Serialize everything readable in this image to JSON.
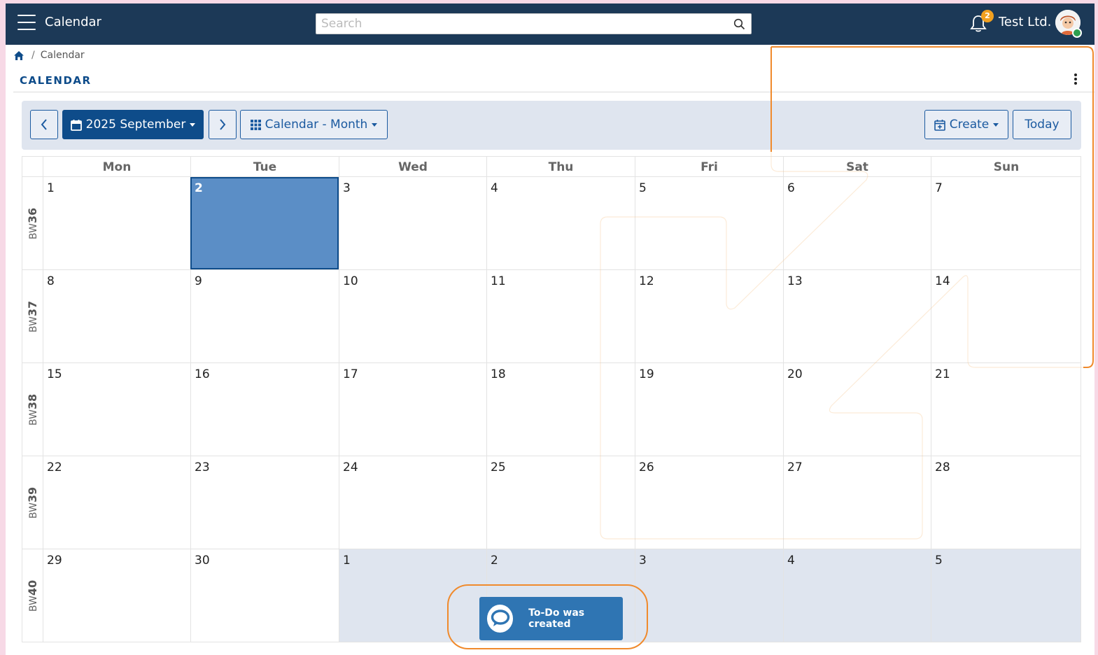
{
  "header": {
    "app_title": "Calendar",
    "search_placeholder": "Search",
    "notification_count": "2",
    "company": "Test Ltd."
  },
  "breadcrumb": {
    "current": "Calendar"
  },
  "page": {
    "heading": "CALENDAR"
  },
  "toolbar": {
    "month_label": "2025 September",
    "view_label": "Calendar - Month",
    "create_label": "Create",
    "today_label": "Today"
  },
  "calendar": {
    "days_of_week": [
      "Mon",
      "Tue",
      "Wed",
      "Thu",
      "Fri",
      "Sat",
      "Sun"
    ],
    "weeks": [
      {
        "prefix": "BW",
        "number": "36",
        "days": [
          "1",
          "2",
          "3",
          "4",
          "5",
          "6",
          "7"
        ]
      },
      {
        "prefix": "BW",
        "number": "37",
        "days": [
          "8",
          "9",
          "10",
          "11",
          "12",
          "13",
          "14"
        ]
      },
      {
        "prefix": "BW",
        "number": "38",
        "days": [
          "15",
          "16",
          "17",
          "18",
          "19",
          "20",
          "21"
        ]
      },
      {
        "prefix": "BW",
        "number": "39",
        "days": [
          "22",
          "23",
          "24",
          "25",
          "26",
          "27",
          "28"
        ]
      },
      {
        "prefix": "BW",
        "number": "40",
        "days": [
          "29",
          "30",
          "1",
          "2",
          "3",
          "4",
          "5"
        ]
      }
    ],
    "selected": {
      "week": 0,
      "day": 1
    },
    "other_month_cells": [
      [
        4,
        2
      ],
      [
        4,
        3
      ],
      [
        4,
        4
      ],
      [
        4,
        5
      ],
      [
        4,
        6
      ]
    ]
  },
  "toast": {
    "message": "To-Do was created"
  },
  "colors": {
    "topbar": "#1c3957",
    "primary": "#0e4c8a",
    "selected_day": "#5b8ec6",
    "toast": "#2f75b3",
    "highlight": "#f08a2c",
    "badge": "#f0a020"
  }
}
